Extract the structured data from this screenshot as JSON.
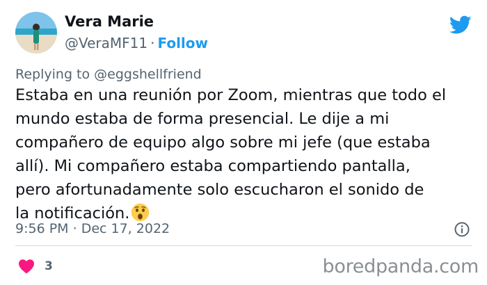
{
  "author": {
    "name": "Vera Marie",
    "handle": "@VeraMF11",
    "separator": "·",
    "follow_label": "Follow",
    "avatar_icon": "avatar-beach-photo"
  },
  "header_icons": {
    "logo": "twitter-bird-icon"
  },
  "reply": {
    "prefix": "Replying to",
    "mention": "@eggshellfriend"
  },
  "tweet": {
    "text": "Estaba en una reunión por Zoom, mientras que todo el\nmundo estaba de forma presencial. Le dije a mi\ncompañero de equipo algo sobre mi jefe (que estaba\nallí). Mi compañero estaba compartiendo pantalla,\npero afortunadamente solo escucharon el sonido de\nla notificación.",
    "emoji": "astonished-face-emoji"
  },
  "meta": {
    "time": "9:56 PM",
    "separator": "·",
    "date": "Dec 17, 2022",
    "info_icon": "info-icon"
  },
  "engagement": {
    "like_icon": "heart-icon",
    "likes": "3"
  },
  "watermark": "boredpanda.com",
  "colors": {
    "accent": "#1d9bf0",
    "like": "#f91880",
    "secondary_text": "#536471",
    "primary_text": "#0f1419"
  }
}
